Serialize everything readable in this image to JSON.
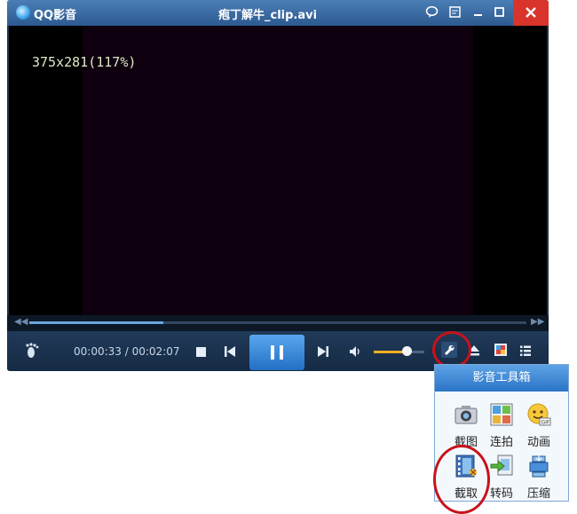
{
  "window": {
    "app_name": "QQ影音",
    "title": "疱丁解牛_clip.avi"
  },
  "video": {
    "osd_text": "375x281(117%)"
  },
  "playback": {
    "time_display": "00:00:33 / 00:02:07",
    "progress_fraction": 0.27,
    "volume_fraction": 0.65
  },
  "toolbox": {
    "title": "影音工具箱",
    "tools": [
      {
        "label": "截图",
        "icon": "camera-icon"
      },
      {
        "label": "连拍",
        "icon": "grid-icon"
      },
      {
        "label": "动画",
        "icon": "gif-smiley-icon"
      },
      {
        "label": "截取",
        "icon": "film-cut-icon"
      },
      {
        "label": "转码",
        "icon": "convert-icon"
      },
      {
        "label": "压缩",
        "icon": "compress-icon"
      }
    ]
  },
  "colors": {
    "highlight": "#c8121b",
    "accent": "#2b74c6",
    "volume": "#f0b022"
  }
}
